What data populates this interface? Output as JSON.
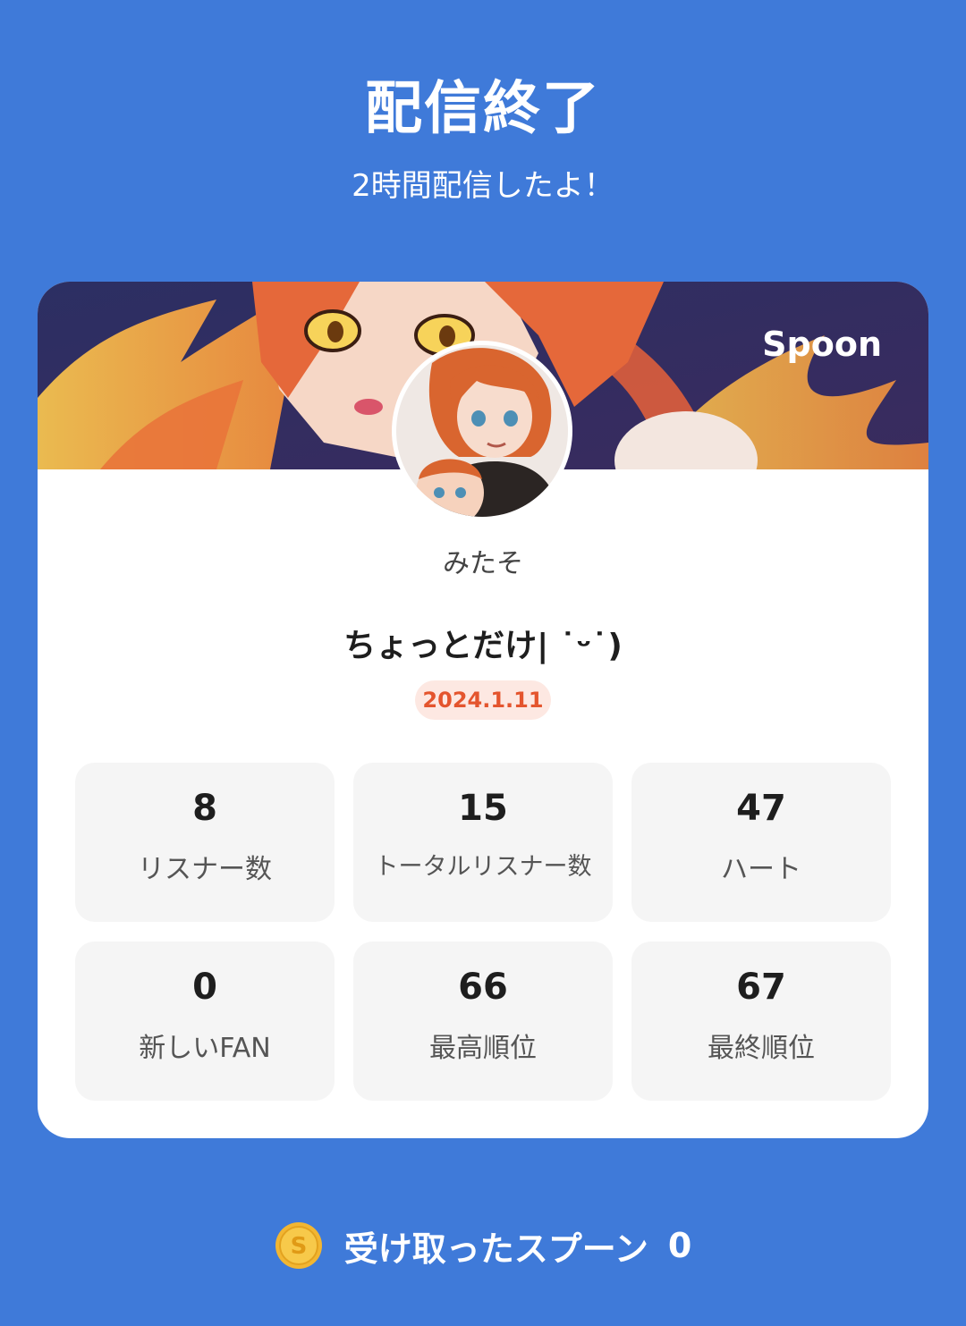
{
  "header": {
    "title": "配信終了",
    "subtitle": "2時間配信したよ！"
  },
  "card": {
    "brand": "Spoon",
    "username": "みたそ",
    "stream_title": "ちょっとだけ|  ˙ᵕ˙)",
    "date": "2024.1.11"
  },
  "stats": [
    {
      "value": "8",
      "label": "リスナー数"
    },
    {
      "value": "15",
      "label": "トータルリスナー数"
    },
    {
      "value": "47",
      "label": "ハート"
    },
    {
      "value": "0",
      "label": "新しいFAN"
    },
    {
      "value": "66",
      "label": "最高順位"
    },
    {
      "value": "67",
      "label": "最終順位"
    }
  ],
  "footer": {
    "label": "受け取ったスプーン",
    "count": "0",
    "coin_letter": "S"
  },
  "colors": {
    "background": "#3f7ad9",
    "date_accent": "#e4552e",
    "date_badge_bg": "#fde8e2",
    "stat_tile_bg": "#f5f5f5",
    "coin": "#f2b632"
  },
  "icons": {
    "coin": "spoon-coin-icon",
    "avatar": "profile-avatar"
  }
}
